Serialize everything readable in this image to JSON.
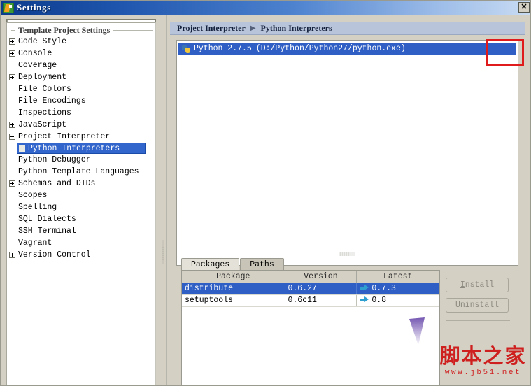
{
  "window": {
    "title": "Settings",
    "app_icon": "pycharm-icon",
    "close_label": "✕"
  },
  "sidebar": {
    "search": {
      "value": "",
      "placeholder": "",
      "clear_icon": "clear-circle-icon"
    },
    "group_title": "Template Project Settings",
    "items": [
      {
        "label": "Code Style",
        "expander": "plus",
        "indent": false,
        "selected": false
      },
      {
        "label": "Console",
        "expander": "plus",
        "indent": false,
        "selected": false
      },
      {
        "label": "Coverage",
        "expander": "none",
        "indent": false,
        "selected": false
      },
      {
        "label": "Deployment",
        "expander": "plus",
        "indent": false,
        "selected": false
      },
      {
        "label": "File Colors",
        "expander": "none",
        "indent": false,
        "selected": false
      },
      {
        "label": "File Encodings",
        "expander": "none",
        "indent": false,
        "selected": false
      },
      {
        "label": "Inspections",
        "expander": "none",
        "indent": false,
        "selected": false
      },
      {
        "label": "JavaScript",
        "expander": "plus",
        "indent": false,
        "selected": false
      },
      {
        "label": "Project Interpreter",
        "expander": "minus",
        "indent": false,
        "selected": false
      },
      {
        "label": "Python Interpreters",
        "expander": "none",
        "indent": true,
        "selected": true
      },
      {
        "label": "Python Debugger",
        "expander": "none",
        "indent": false,
        "selected": false
      },
      {
        "label": "Python Template Languages",
        "expander": "none",
        "indent": false,
        "selected": false
      },
      {
        "label": "Schemas and DTDs",
        "expander": "plus",
        "indent": false,
        "selected": false
      },
      {
        "label": "Scopes",
        "expander": "none",
        "indent": false,
        "selected": false
      },
      {
        "label": "Spelling",
        "expander": "none",
        "indent": false,
        "selected": false
      },
      {
        "label": "SQL Dialects",
        "expander": "none",
        "indent": false,
        "selected": false
      },
      {
        "label": "SSH Terminal",
        "expander": "none",
        "indent": false,
        "selected": false
      },
      {
        "label": "Vagrant",
        "expander": "none",
        "indent": false,
        "selected": false
      },
      {
        "label": "Version Control",
        "expander": "plus",
        "indent": false,
        "selected": false
      }
    ]
  },
  "main": {
    "breadcrumb": {
      "parent": "Project Interpreter",
      "separator": "▶",
      "current": "Python Interpreters"
    },
    "interpreters": [
      {
        "name": "Python 2.7.5",
        "path": "(D:/Python/Python27/python.exe)",
        "selected": true
      }
    ],
    "toolbar": [
      {
        "name": "add-interpreter-button",
        "icon": "plus-icon",
        "color": "#3f9e3f"
      },
      {
        "name": "remove-interpreter-button",
        "icon": "minus-icon",
        "color": "#c9443c"
      },
      {
        "name": "edit-interpreter-button",
        "icon": "pencil-icon",
        "color": "#55a83f"
      },
      {
        "name": "create-virtualenv-button",
        "icon": "python-venv-icon",
        "color": "#3c8bc0"
      },
      {
        "name": "filter-button",
        "icon": "filter-funnel-icon",
        "color": "#3e8fc9"
      }
    ],
    "tabs": [
      {
        "label": "Packages",
        "active": true
      },
      {
        "label": "Paths",
        "active": false
      }
    ],
    "packages_table": {
      "columns": [
        "Package",
        "Version",
        "Latest"
      ],
      "rows": [
        {
          "package": "distribute",
          "version": "0.6.27",
          "latest": "0.7.3",
          "has_upgrade_arrow": true,
          "selected": true
        },
        {
          "package": "setuptools",
          "version": "0.6c11",
          "latest": "0.8",
          "has_upgrade_arrow": true,
          "selected": false
        }
      ]
    },
    "buttons": [
      {
        "label": "Install",
        "mnemonic": "I",
        "rest": "nstall",
        "enabled": false
      },
      {
        "label": "Uninstall",
        "mnemonic": "U",
        "rest": "ninstall",
        "enabled": false
      }
    ]
  },
  "annotation": {
    "highlight_color": "#e01b1b",
    "target": "add-interpreter-button"
  },
  "watermark": {
    "chinese": "脚本之家",
    "url": "www.jb51.net",
    "color": "#cf2020"
  }
}
